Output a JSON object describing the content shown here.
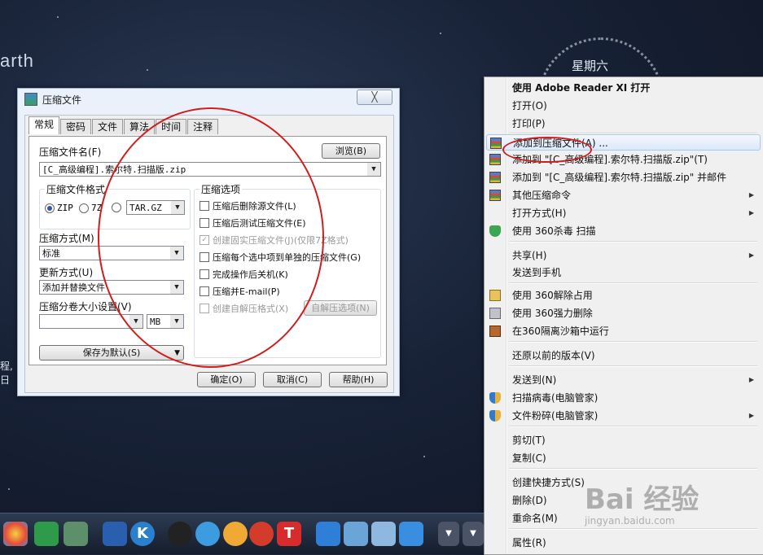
{
  "desktop": {
    "earth_text": "arth",
    "weekday": "星期六",
    "side_lines": [
      "程,",
      "日"
    ]
  },
  "dialog": {
    "title": "压缩文件",
    "close_label": "╳",
    "tabs": [
      "常规",
      "密码",
      "文件",
      "算法",
      "时间",
      "注释"
    ],
    "archive_name_label": "压缩文件名(F)",
    "browse_button": "浏览(B)",
    "archive_name_value": "[C_高级编程].索尔特.扫描版.zip",
    "format_group_title": "压缩文件格式",
    "format_options": [
      "ZIP",
      "7Z",
      "TAR.GZ"
    ],
    "format_selected": "ZIP",
    "method_label": "压缩方式(M)",
    "method_value": "标准",
    "update_label": "更新方式(U)",
    "update_value": "添加并替换文件",
    "split_label": "压缩分卷大小设置(V)",
    "split_value": "",
    "split_unit": "MB",
    "save_default_button": "保存为默认(S)",
    "options_group_title": "压缩选项",
    "options": [
      {
        "label": "压缩后删除源文件(L)",
        "checked": false,
        "disabled": false
      },
      {
        "label": "压缩后测试压缩文件(E)",
        "checked": false,
        "disabled": false
      },
      {
        "label": "创建固实压缩文件(J)(仅限7Z格式)",
        "checked": true,
        "disabled": true
      },
      {
        "label": "压缩每个选中项到单独的压缩文件(G)",
        "checked": false,
        "disabled": false
      },
      {
        "label": "完成操作后关机(K)",
        "checked": false,
        "disabled": false
      },
      {
        "label": "压缩并E-mail(P)",
        "checked": false,
        "disabled": false
      },
      {
        "label": "创建自解压格式(X)",
        "checked": false,
        "disabled": true
      }
    ],
    "sfx_options_button": "自解压选项(N)",
    "ok_button": "确定(O)",
    "cancel_button": "取消(C)",
    "help_button": "帮助(H)"
  },
  "context_menu": {
    "items": [
      {
        "label": "使用 Adobe Reader XI 打开",
        "bold": true
      },
      {
        "label": "打开(O)"
      },
      {
        "label": "打印(P)"
      },
      {
        "label": "添加到压缩文件(A) ...",
        "highlighted": true,
        "icon": "winrar-icon"
      },
      {
        "label": "添加到 \"[C_高级编程].索尔特.扫描版.zip\"(T)",
        "icon": "winrar-icon"
      },
      {
        "label": "添加到 \"[C_高级编程].索尔特.扫描版.zip\" 并邮件",
        "icon": "winrar-icon"
      },
      {
        "label": "其他压缩命令",
        "icon": "winrar-icon",
        "submenu": true
      },
      {
        "label": "打开方式(H)",
        "submenu": true
      },
      {
        "label": "使用 360杀毒 扫描",
        "icon": "shield-icon"
      },
      {
        "label": "共享(H)",
        "submenu": true
      },
      {
        "label": "发送到手机"
      },
      {
        "label": "使用 360解除占用",
        "icon": "unlock-icon"
      },
      {
        "label": "使用 360强力删除",
        "icon": "shredder-icon"
      },
      {
        "label": "在360隔离沙箱中运行",
        "icon": "sandbox-icon"
      },
      {
        "label": "还原以前的版本(V)"
      },
      {
        "label": "发送到(N)",
        "submenu": true
      },
      {
        "label": "扫描病毒(电脑管家)",
        "icon": "guard-shield-icon"
      },
      {
        "label": "文件粉碎(电脑管家)",
        "icon": "guard-shield-icon",
        "submenu": true
      },
      {
        "label": "剪切(T)"
      },
      {
        "label": "复制(C)"
      },
      {
        "label": "创建快捷方式(S)"
      },
      {
        "label": "删除(D)"
      },
      {
        "label": "重命名(M)"
      },
      {
        "label": "属性(R)"
      }
    ],
    "watermark_main": "Bai 经验",
    "watermark_sub": "jingyan.baidu.com"
  },
  "taskbar": {
    "icons": [
      "browser-icon",
      "360-guard-icon",
      "game-icon",
      "app-grid-icon",
      "k-icon",
      "qq-icon",
      "bird-icon",
      "chat-icon",
      "weibo-icon",
      "t-icon",
      "cloud-icon",
      "box-icon",
      "photo-icon",
      "pen-icon"
    ],
    "k_label": "K",
    "t_label": "T"
  }
}
